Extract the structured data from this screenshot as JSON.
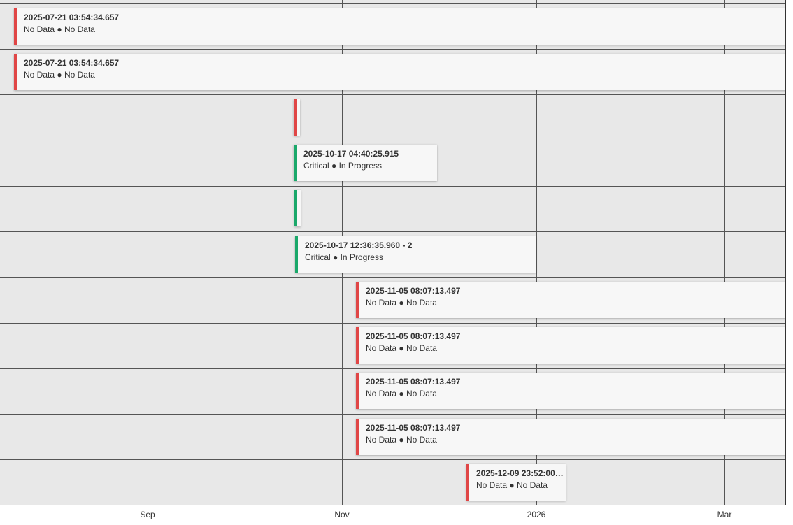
{
  "axis": {
    "ticks": [
      "Sep",
      "Nov",
      "2026",
      "Mar"
    ]
  },
  "colors": {
    "red": "#e04646",
    "green": "#1aa86a"
  },
  "items": [
    {
      "title": "2025-07-21 03:54:34.657",
      "severity": "No Data",
      "status": "No Data",
      "color": "red"
    },
    {
      "title": "2025-07-21 03:54:34.657",
      "severity": "No Data",
      "status": "No Data",
      "color": "red"
    },
    {
      "title": "",
      "severity": "",
      "status": "",
      "color": "red"
    },
    {
      "title": "2025-10-17 04:40:25.915",
      "severity": "Critical",
      "status": "In Progress",
      "color": "green"
    },
    {
      "title": "",
      "severity": "",
      "status": "",
      "color": "green"
    },
    {
      "title": "2025-10-17 12:36:35.960 - 2",
      "severity": "Critical",
      "status": "In Progress",
      "color": "green"
    },
    {
      "title": "2025-11-05 08:07:13.497",
      "severity": "No Data",
      "status": "No Data",
      "color": "red"
    },
    {
      "title": "2025-11-05 08:07:13.497",
      "severity": "No Data",
      "status": "No Data",
      "color": "red"
    },
    {
      "title": "2025-11-05 08:07:13.497",
      "severity": "No Data",
      "status": "No Data",
      "color": "red"
    },
    {
      "title": "2025-11-05 08:07:13.497",
      "severity": "No Data",
      "status": "No Data",
      "color": "red"
    },
    {
      "title": "2025-12-09 23:52:00…",
      "severity": "No Data",
      "status": "No Data",
      "color": "red"
    }
  ]
}
